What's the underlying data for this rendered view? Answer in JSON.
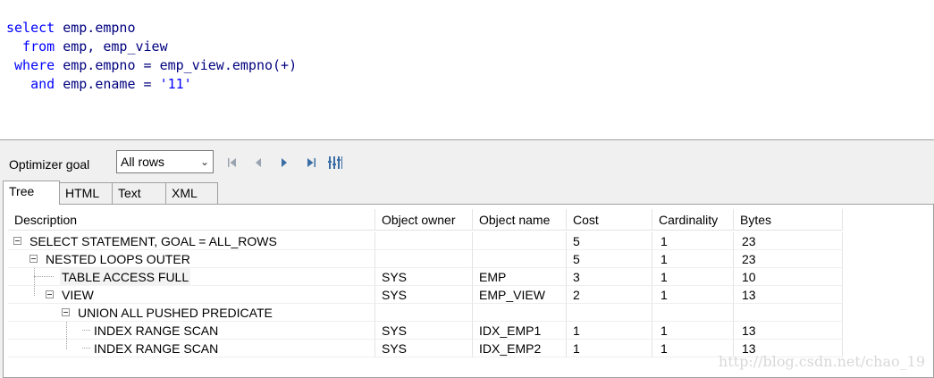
{
  "editor": {
    "lines": [
      {
        "kw": "select",
        "rest": " emp.empno"
      },
      {
        "kw": "  from",
        "rest": " emp, emp_view"
      },
      {
        "kw": " where",
        "rest": " emp.empno = emp_view.empno(+)"
      },
      {
        "kw": "   and",
        "rest": " emp.ename = ",
        "str": "'11'"
      }
    ]
  },
  "toolbar": {
    "optimizer_label": "Optimizer goal",
    "optimizer_value": "All rows",
    "nav_icons": [
      "first-icon",
      "prev-icon",
      "next-icon",
      "last-icon",
      "columns-icon"
    ]
  },
  "tabs": [
    "Tree",
    "HTML",
    "Text",
    "XML"
  ],
  "grid": {
    "columns": [
      "Description",
      "Object owner",
      "Object name",
      "Cost",
      "Cardinality",
      "Bytes"
    ],
    "rows": [
      {
        "desc": "SELECT STATEMENT, GOAL = ALL_ROWS",
        "owner": "",
        "name": "",
        "cost": "5",
        "card": "1",
        "bytes": "23"
      },
      {
        "desc": "NESTED LOOPS OUTER",
        "owner": "",
        "name": "",
        "cost": "5",
        "card": "1",
        "bytes": "23"
      },
      {
        "desc": "TABLE ACCESS FULL",
        "owner": "SYS",
        "name": "EMP",
        "cost": "3",
        "card": "1",
        "bytes": "10"
      },
      {
        "desc": "VIEW",
        "owner": "SYS",
        "name": "EMP_VIEW",
        "cost": "2",
        "card": "1",
        "bytes": "13"
      },
      {
        "desc": "UNION ALL PUSHED PREDICATE",
        "owner": "",
        "name": "",
        "cost": "",
        "card": "",
        "bytes": ""
      },
      {
        "desc": "INDEX RANGE SCAN",
        "owner": "SYS",
        "name": "IDX_EMP1",
        "cost": "1",
        "card": "1",
        "bytes": "13"
      },
      {
        "desc": "INDEX RANGE SCAN",
        "owner": "SYS",
        "name": "IDX_EMP2",
        "cost": "1",
        "card": "1",
        "bytes": "13"
      }
    ]
  },
  "watermark": "http://blog.csdn.net/chao_19"
}
